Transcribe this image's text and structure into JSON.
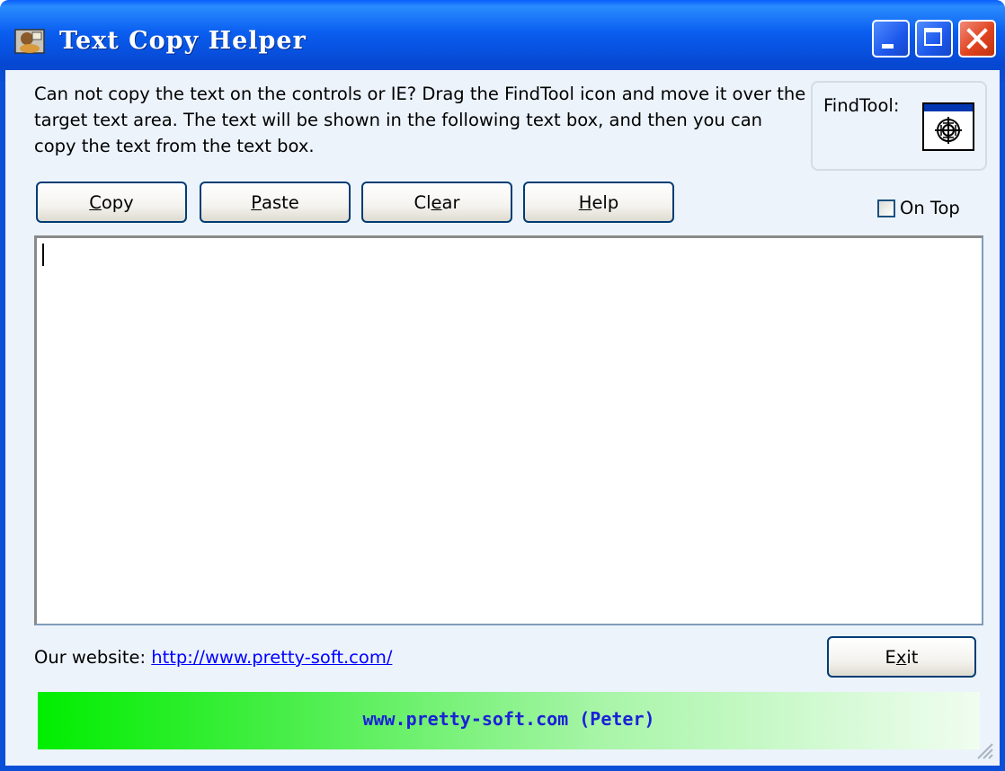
{
  "window": {
    "title": "Text Copy Helper"
  },
  "description": "Can not copy the text on the controls or IE?  Drag the FindTool icon and move it over the target text area. The text will be shown in the following text box, and then you can copy the text from the text box.",
  "findtool": {
    "label": "FindTool:",
    "icon": "crosshair-target-icon"
  },
  "buttons": {
    "copy_pre": "",
    "copy_key": "C",
    "copy_post": "opy",
    "paste_pre": "",
    "paste_key": "P",
    "paste_post": "aste",
    "clear_pre": "Cl",
    "clear_key": "e",
    "clear_post": "ar",
    "help_pre": "",
    "help_key": "H",
    "help_post": "elp",
    "exit_pre": "E",
    "exit_key": "x",
    "exit_post": "it"
  },
  "ontop": {
    "label": "On Top",
    "checked": false
  },
  "textbox": {
    "value": ""
  },
  "website": {
    "label": "Our website: ",
    "url": "http://www.pretty-soft.com/"
  },
  "banner": {
    "text": "www.pretty-soft.com  (Peter)"
  },
  "colors": {
    "titlebar": "#0a5ef0",
    "client_bg": "#ecf3fb",
    "link": "#0000ff",
    "banner_start": "#00ee00",
    "banner_text": "#1a22d8"
  }
}
